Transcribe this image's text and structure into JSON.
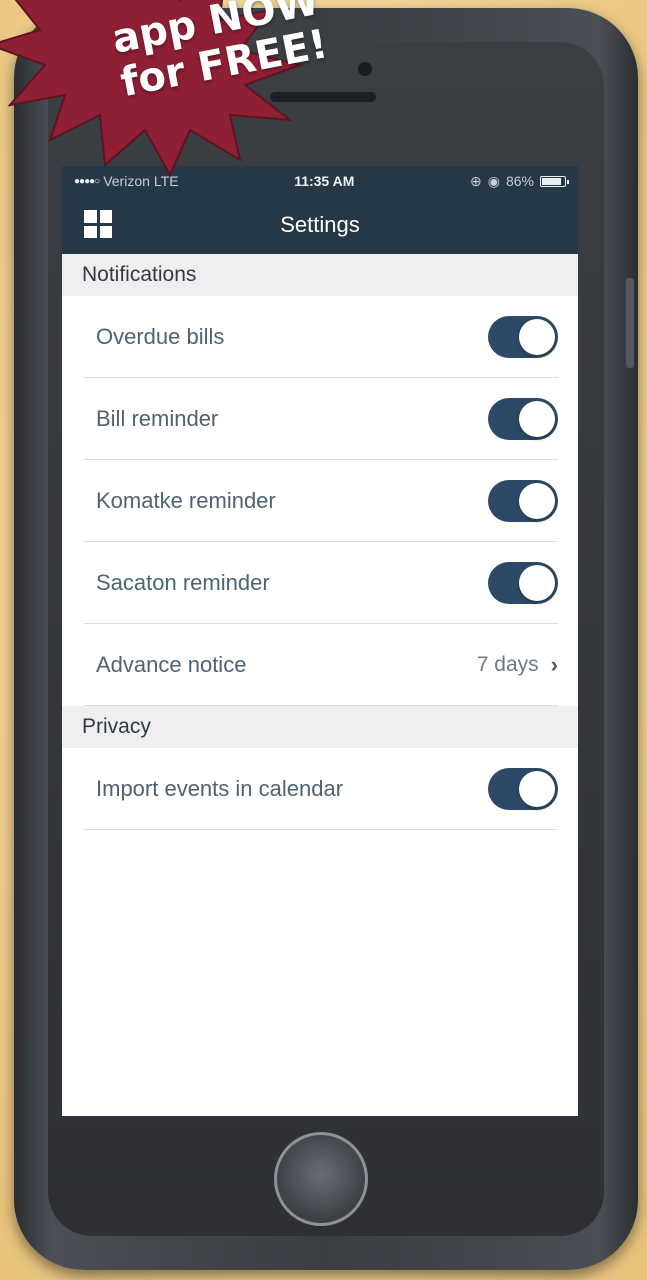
{
  "badge": {
    "line1": "app NOW",
    "line2": "for FREE!",
    "color": "#8f1f34"
  },
  "status_bar": {
    "carrier": "Verizon",
    "network": "LTE",
    "time": "11:35 AM",
    "battery": "86%",
    "battery_level": 0.86
  },
  "nav": {
    "title": "Settings",
    "menu_icon": "grid-icon"
  },
  "sections": {
    "notifications": {
      "header": "Notifications",
      "rows": [
        {
          "label": "Overdue bills",
          "toggle_on": true
        },
        {
          "label": "Bill reminder",
          "toggle_on": true
        },
        {
          "label": "Komatke reminder",
          "toggle_on": true
        },
        {
          "label": "Sacaton reminder",
          "toggle_on": true
        }
      ],
      "advance_notice": {
        "label": "Advance notice",
        "value": "7 days"
      }
    },
    "privacy": {
      "header": "Privacy",
      "rows": [
        {
          "label": "Import events in calendar",
          "toggle_on": true
        }
      ]
    }
  },
  "colors": {
    "nav_bg": "#263845",
    "toggle_on": "#2c4a67",
    "section_bg": "#efeff1",
    "label": "#4d6374"
  }
}
